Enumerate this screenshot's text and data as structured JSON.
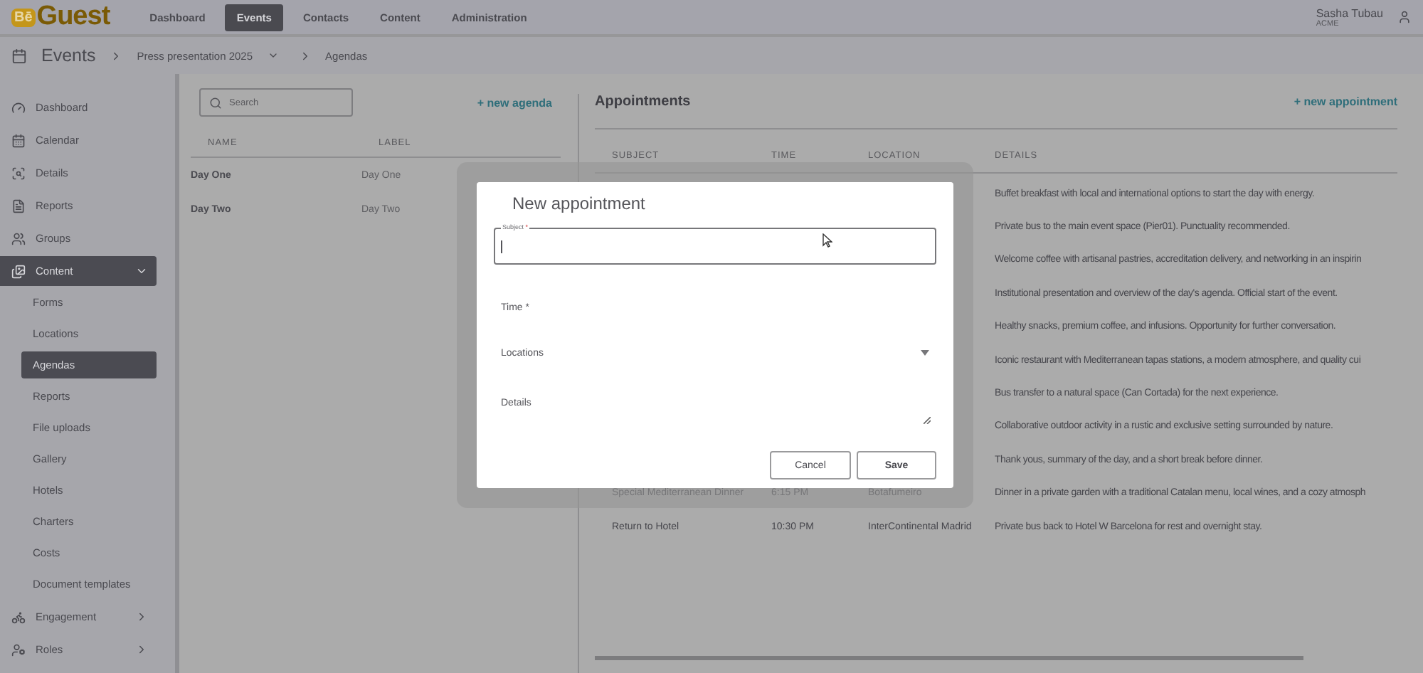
{
  "nav": {
    "logo": {
      "mark": "Bē",
      "word": "Guest"
    },
    "tabs": [
      {
        "label": "Dashboard",
        "selected": false
      },
      {
        "label": "Events",
        "selected": true
      },
      {
        "label": "Contacts",
        "selected": false
      },
      {
        "label": "Content",
        "selected": false
      },
      {
        "label": "Administration",
        "selected": false
      }
    ],
    "user": {
      "name": "Sasha Tubau",
      "org": "ACME"
    }
  },
  "breadcrumb": {
    "section": "Events",
    "event": "Press presentation 2025",
    "page": "Agendas"
  },
  "sidebar": {
    "items": [
      {
        "label": "Dashboard",
        "selected": false
      },
      {
        "label": "Calendar",
        "selected": false
      },
      {
        "label": "Details",
        "selected": false
      },
      {
        "label": "Reports",
        "selected": false
      },
      {
        "label": "Groups",
        "selected": false
      },
      {
        "label": "Content",
        "selected": true,
        "expanded": true,
        "children": [
          {
            "label": "Forms",
            "selected": false
          },
          {
            "label": "Locations",
            "selected": false
          },
          {
            "label": "Agendas",
            "selected": true
          },
          {
            "label": "Reports",
            "selected": false
          },
          {
            "label": "File uploads",
            "selected": false
          },
          {
            "label": "Gallery",
            "selected": false
          },
          {
            "label": "Hotels",
            "selected": false
          },
          {
            "label": "Charters",
            "selected": false
          },
          {
            "label": "Costs",
            "selected": false
          },
          {
            "label": "Document templates",
            "selected": false
          }
        ]
      },
      {
        "label": "Engagement",
        "selected": false,
        "expanded": false
      },
      {
        "label": "Roles",
        "selected": false,
        "expanded": false
      }
    ]
  },
  "agendas": {
    "search": {
      "placeholder": "Search"
    },
    "add_link": "+ new agenda",
    "columns": [
      "NAME",
      "LABEL"
    ],
    "rows": [
      {
        "name": "Day One",
        "label": "Day One"
      },
      {
        "name": "Day Two",
        "label": "Day Two"
      }
    ]
  },
  "appointments": {
    "title": "Appointments",
    "add_link": "+ new appointment",
    "columns": [
      "SUBJECT",
      "TIME",
      "LOCATION",
      "DETAILS"
    ],
    "rows": [
      {
        "details": "Buffet breakfast with local and international options to start the day with energy."
      },
      {
        "details": "Private bus to the main event space (Pier01). Punctuality recommended."
      },
      {
        "details": "Welcome coffee with artisanal pastries, accreditation delivery, and networking in an inspirin"
      },
      {
        "details": "Institutional presentation and overview of the day's agenda. Official start of the event."
      },
      {
        "details": "Healthy snacks, premium coffee, and infusions. Opportunity for further conversation."
      },
      {
        "details": "Iconic restaurant with Mediterranean tapas stations, a modern atmosphere, and quality cui"
      },
      {
        "details": "Bus transfer to a natural space (Can Cortada) for the next experience."
      },
      {
        "details": "Collaborative outdoor activity in a rustic and exclusive setting surrounded by nature."
      },
      {
        "details": "Thank yous, summary of the day, and a short break before dinner."
      },
      {
        "subject": "Special Mediterranean Dinner",
        "time": "6:15 PM",
        "location": "Botafumeiro",
        "details": "Dinner in a private garden with a traditional Catalan menu, local wines, and a cozy atmosph"
      },
      {
        "subject": "Return to Hotel",
        "time": "10:30 PM",
        "location": "InterContinental Madrid",
        "details": "Private bus back to Hotel W Barcelona for rest and overnight stay."
      }
    ]
  },
  "dialog": {
    "title": "New appointment",
    "fields": [
      {
        "kind": "outlined",
        "label": "Subject",
        "required_mark": "*",
        "focused": true
      },
      {
        "kind": "plain",
        "label": "Time *"
      },
      {
        "kind": "select",
        "label": "Locations"
      },
      {
        "kind": "textarea",
        "label": "Details"
      }
    ],
    "buttons": [
      {
        "label": "Cancel",
        "kind": "secondary"
      },
      {
        "label": "Save",
        "kind": "primary"
      }
    ]
  }
}
